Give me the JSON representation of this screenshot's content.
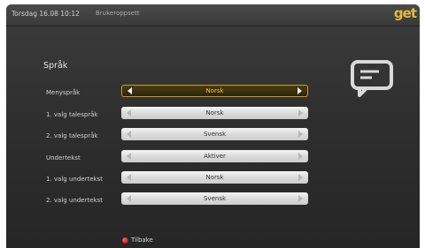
{
  "status_bar": {
    "datetime": "Torsdag 16.08 10:12",
    "breadcrumb": "Brukeroppsett",
    "logo_text": "get"
  },
  "section": {
    "title": "Språk"
  },
  "settings": [
    {
      "label": "Menyspråk",
      "value": "Norsk",
      "focused": true
    },
    {
      "label": "1. valg talespråk",
      "value": "Norsk",
      "focused": false
    },
    {
      "label": "2. valg talespråk",
      "value": "Svensk",
      "focused": false
    },
    {
      "label": "Undertekst",
      "value": "Aktiver",
      "focused": false
    },
    {
      "label": "1. valg undertekst",
      "value": "Norsk",
      "focused": false
    },
    {
      "label": "2. valg undertekst",
      "value": "Svensk",
      "focused": false
    }
  ],
  "footer": {
    "back_label": "Tilbake",
    "back_key_color": "red"
  },
  "colors": {
    "accent": "#e7b83c",
    "focus_text": "#f3c23f",
    "background": "#2f2f2f"
  },
  "icons": {
    "message": "speech-bubble-icon",
    "back_key": "red-button-icon"
  }
}
